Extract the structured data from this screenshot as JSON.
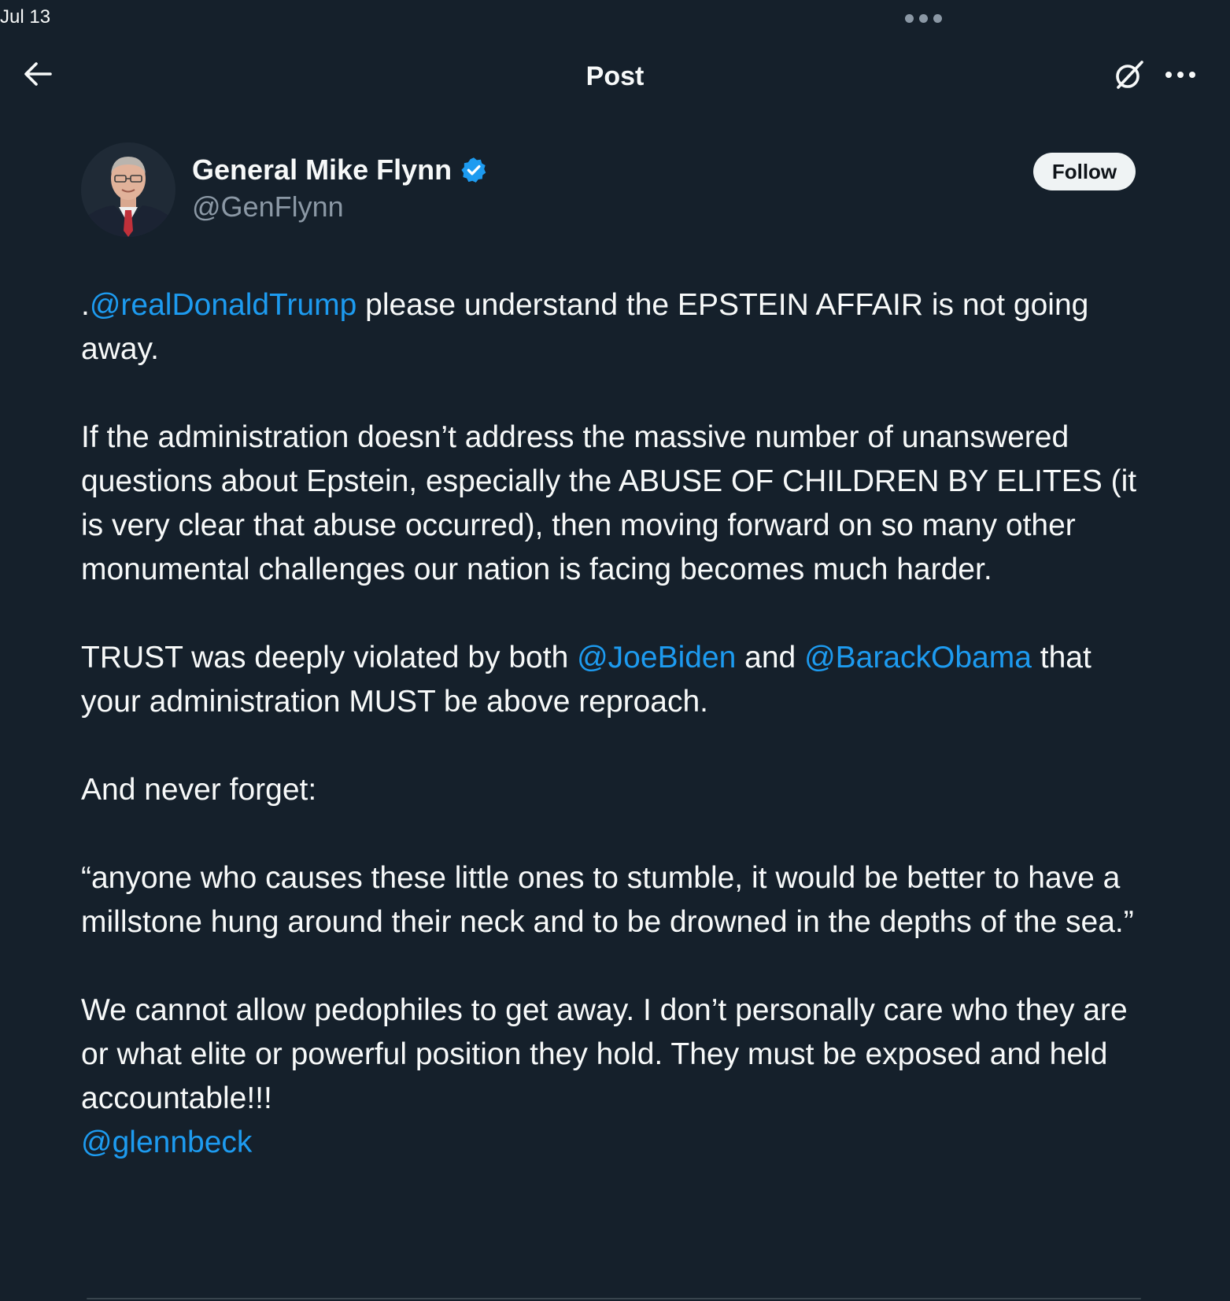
{
  "status_bar": {
    "date": "Jul 13"
  },
  "nav": {
    "title": "Post",
    "back_icon": "arrow-left-icon",
    "grok_icon": "grok-icon",
    "more_icon": "more-horizontal-icon"
  },
  "author": {
    "name": "General Mike Flynn",
    "handle": "@GenFlynn",
    "verified": true,
    "follow_label": "Follow"
  },
  "tweet": {
    "p1_prefix": ".",
    "p1_mention": "@realDonaldTrump",
    "p1_text": " please understand the EPSTEIN AFFAIR is not going away.",
    "p2_text": "If the administration doesn’t address the massive number of unanswered questions about Epstein, especially the ABUSE OF CHILDREN BY ELITES (it is very clear that abuse occurred), then moving forward on so many other monumental challenges our nation is facing becomes much harder.",
    "p3_text_a": "TRUST was deeply violated by both ",
    "p3_mention_a": "@JoeBiden",
    "p3_text_b": " and ",
    "p3_mention_b": "@BarackObama",
    "p3_text_c": " that your administration MUST be above reproach.",
    "p4_text": "And never forget:",
    "p5_text": "“anyone who causes these little ones to stumble, it would be better to have a millstone hung around their neck and to be drowned in the depths of the sea.”",
    "p6_text": "We cannot allow pedophiles to get away. I don’t personally care who they are or what elite or powerful position they hold. They must be exposed and held accountable!!!",
    "p6_mention": "@glennbeck"
  },
  "colors": {
    "background": "#15202b",
    "text": "#f7f9f9",
    "secondary_text": "#8b98a5",
    "link": "#1d9bf0",
    "verified_badge": "#1d9bf0"
  }
}
